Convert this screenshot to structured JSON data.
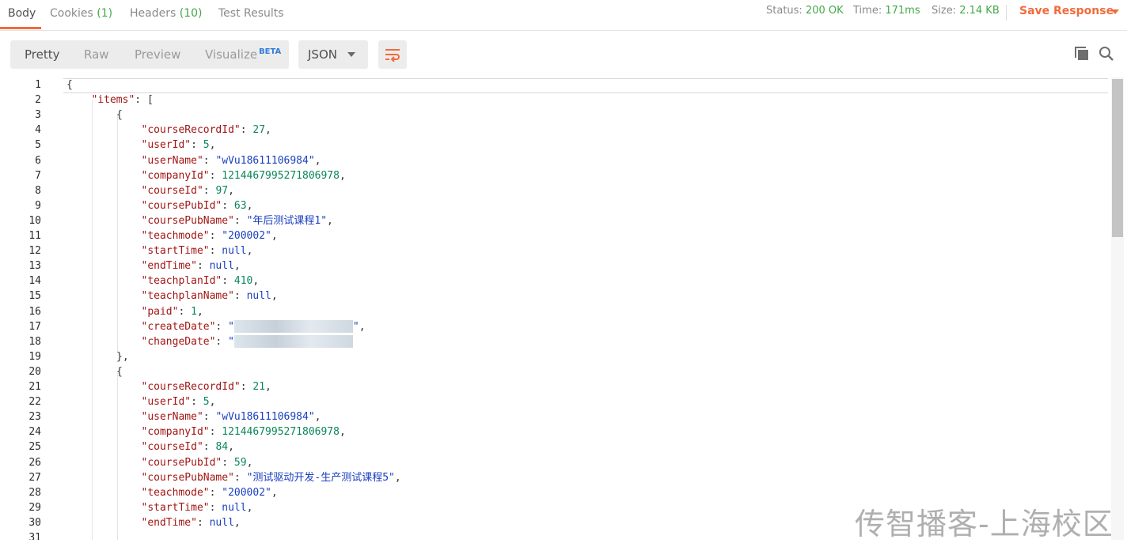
{
  "tabs": [
    {
      "label": "Body",
      "count": ""
    },
    {
      "label": "Cookies",
      "count": "(1)"
    },
    {
      "label": "Headers",
      "count": "(10)"
    },
    {
      "label": "Test Results",
      "count": ""
    }
  ],
  "status": {
    "label": "Status:",
    "value": "200 OK"
  },
  "time": {
    "label": "Time:",
    "value": "171ms"
  },
  "size": {
    "label": "Size:",
    "value": "2.14 KB"
  },
  "save_response": "Save Response",
  "format_tabs": [
    "Pretty",
    "Raw",
    "Preview",
    "Visualize"
  ],
  "beta_badge": "BETA",
  "language": "JSON",
  "icons": {
    "wrap": "wrap-lines-icon",
    "copy": "copy-icon",
    "search": "search-icon",
    "dropdown": "chevron-down-icon"
  },
  "colors": {
    "accent": "#f26b3a",
    "success": "#45a84a",
    "key": "#a31515",
    "string": "#1a3fc1",
    "number": "#098658"
  },
  "code_lines": [
    {
      "n": "1",
      "indent": 0,
      "segs": [
        [
          "p",
          "{"
        ]
      ]
    },
    {
      "n": "2",
      "indent": 1,
      "segs": [
        [
          "k",
          "\"items\""
        ],
        [
          "p",
          ": ["
        ]
      ]
    },
    {
      "n": "3",
      "indent": 2,
      "segs": [
        [
          "p",
          "{"
        ]
      ]
    },
    {
      "n": "4",
      "indent": 3,
      "segs": [
        [
          "k",
          "\"courseRecordId\""
        ],
        [
          "p",
          ": "
        ],
        [
          "n",
          "27"
        ],
        [
          "p",
          ","
        ]
      ]
    },
    {
      "n": "5",
      "indent": 3,
      "segs": [
        [
          "k",
          "\"userId\""
        ],
        [
          "p",
          ": "
        ],
        [
          "n",
          "5"
        ],
        [
          "p",
          ","
        ]
      ]
    },
    {
      "n": "6",
      "indent": 3,
      "segs": [
        [
          "k",
          "\"userName\""
        ],
        [
          "p",
          ": "
        ],
        [
          "s",
          "\"wVu18611106984\""
        ],
        [
          "p",
          ","
        ]
      ]
    },
    {
      "n": "7",
      "indent": 3,
      "segs": [
        [
          "k",
          "\"companyId\""
        ],
        [
          "p",
          ": "
        ],
        [
          "n",
          "1214467995271806978"
        ],
        [
          "p",
          ","
        ]
      ]
    },
    {
      "n": "8",
      "indent": 3,
      "segs": [
        [
          "k",
          "\"courseId\""
        ],
        [
          "p",
          ": "
        ],
        [
          "n",
          "97"
        ],
        [
          "p",
          ","
        ]
      ]
    },
    {
      "n": "9",
      "indent": 3,
      "segs": [
        [
          "k",
          "\"coursePubId\""
        ],
        [
          "p",
          ": "
        ],
        [
          "n",
          "63"
        ],
        [
          "p",
          ","
        ]
      ]
    },
    {
      "n": "10",
      "indent": 3,
      "segs": [
        [
          "k",
          "\"coursePubName\""
        ],
        [
          "p",
          ": "
        ],
        [
          "s",
          "\"年后测试课程1\""
        ],
        [
          "p",
          ","
        ]
      ]
    },
    {
      "n": "11",
      "indent": 3,
      "segs": [
        [
          "k",
          "\"teachmode\""
        ],
        [
          "p",
          ": "
        ],
        [
          "s",
          "\"200002\""
        ],
        [
          "p",
          ","
        ]
      ]
    },
    {
      "n": "12",
      "indent": 3,
      "segs": [
        [
          "k",
          "\"startTime\""
        ],
        [
          "p",
          ": "
        ],
        [
          "nl",
          "null"
        ],
        [
          "p",
          ","
        ]
      ]
    },
    {
      "n": "13",
      "indent": 3,
      "segs": [
        [
          "k",
          "\"endTime\""
        ],
        [
          "p",
          ": "
        ],
        [
          "nl",
          "null"
        ],
        [
          "p",
          ","
        ]
      ]
    },
    {
      "n": "14",
      "indent": 3,
      "segs": [
        [
          "k",
          "\"teachplanId\""
        ],
        [
          "p",
          ": "
        ],
        [
          "n",
          "410"
        ],
        [
          "p",
          ","
        ]
      ]
    },
    {
      "n": "15",
      "indent": 3,
      "segs": [
        [
          "k",
          "\"teachplanName\""
        ],
        [
          "p",
          ": "
        ],
        [
          "nl",
          "null"
        ],
        [
          "p",
          ","
        ]
      ]
    },
    {
      "n": "16",
      "indent": 3,
      "segs": [
        [
          "k",
          "\"paid\""
        ],
        [
          "p",
          ": "
        ],
        [
          "n",
          "1"
        ],
        [
          "p",
          ","
        ]
      ]
    },
    {
      "n": "17",
      "indent": 3,
      "segs": [
        [
          "k",
          "\"createDate\""
        ],
        [
          "p",
          ": "
        ],
        [
          "s",
          "\""
        ],
        [
          "blur",
          "                    "
        ],
        [
          "s",
          "\""
        ],
        [
          "p",
          ","
        ]
      ]
    },
    {
      "n": "18",
      "indent": 3,
      "segs": [
        [
          "k",
          "\"changeDate\""
        ],
        [
          "p",
          ": "
        ],
        [
          "s",
          "\""
        ],
        [
          "blur",
          "                    "
        ]
      ]
    },
    {
      "n": "19",
      "indent": 2,
      "segs": [
        [
          "p",
          "},"
        ]
      ]
    },
    {
      "n": "20",
      "indent": 2,
      "segs": [
        [
          "p",
          "{"
        ]
      ]
    },
    {
      "n": "21",
      "indent": 3,
      "segs": [
        [
          "k",
          "\"courseRecordId\""
        ],
        [
          "p",
          ": "
        ],
        [
          "n",
          "21"
        ],
        [
          "p",
          ","
        ]
      ]
    },
    {
      "n": "22",
      "indent": 3,
      "segs": [
        [
          "k",
          "\"userId\""
        ],
        [
          "p",
          ": "
        ],
        [
          "n",
          "5"
        ],
        [
          "p",
          ","
        ]
      ]
    },
    {
      "n": "23",
      "indent": 3,
      "segs": [
        [
          "k",
          "\"userName\""
        ],
        [
          "p",
          ": "
        ],
        [
          "s",
          "\"wVu18611106984\""
        ],
        [
          "p",
          ","
        ]
      ]
    },
    {
      "n": "24",
      "indent": 3,
      "segs": [
        [
          "k",
          "\"companyId\""
        ],
        [
          "p",
          ": "
        ],
        [
          "n",
          "1214467995271806978"
        ],
        [
          "p",
          ","
        ]
      ]
    },
    {
      "n": "25",
      "indent": 3,
      "segs": [
        [
          "k",
          "\"courseId\""
        ],
        [
          "p",
          ": "
        ],
        [
          "n",
          "84"
        ],
        [
          "p",
          ","
        ]
      ]
    },
    {
      "n": "26",
      "indent": 3,
      "segs": [
        [
          "k",
          "\"coursePubId\""
        ],
        [
          "p",
          ": "
        ],
        [
          "n",
          "59"
        ],
        [
          "p",
          ","
        ]
      ]
    },
    {
      "n": "27",
      "indent": 3,
      "segs": [
        [
          "k",
          "\"coursePubName\""
        ],
        [
          "p",
          ": "
        ],
        [
          "s",
          "\"测试驱动开发-生产测试课程5\""
        ],
        [
          "p",
          ","
        ]
      ]
    },
    {
      "n": "28",
      "indent": 3,
      "segs": [
        [
          "k",
          "\"teachmode\""
        ],
        [
          "p",
          ": "
        ],
        [
          "s",
          "\"200002\""
        ],
        [
          "p",
          ","
        ]
      ]
    },
    {
      "n": "29",
      "indent": 3,
      "segs": [
        [
          "k",
          "\"startTime\""
        ],
        [
          "p",
          ": "
        ],
        [
          "nl",
          "null"
        ],
        [
          "p",
          ","
        ]
      ]
    },
    {
      "n": "30",
      "indent": 3,
      "segs": [
        [
          "k",
          "\"endTime\""
        ],
        [
          "p",
          ": "
        ],
        [
          "nl",
          "null"
        ],
        [
          "p",
          ","
        ]
      ]
    },
    {
      "n": "31",
      "indent": 3,
      "segs": []
    }
  ],
  "watermark": "传智播客-上海校区"
}
